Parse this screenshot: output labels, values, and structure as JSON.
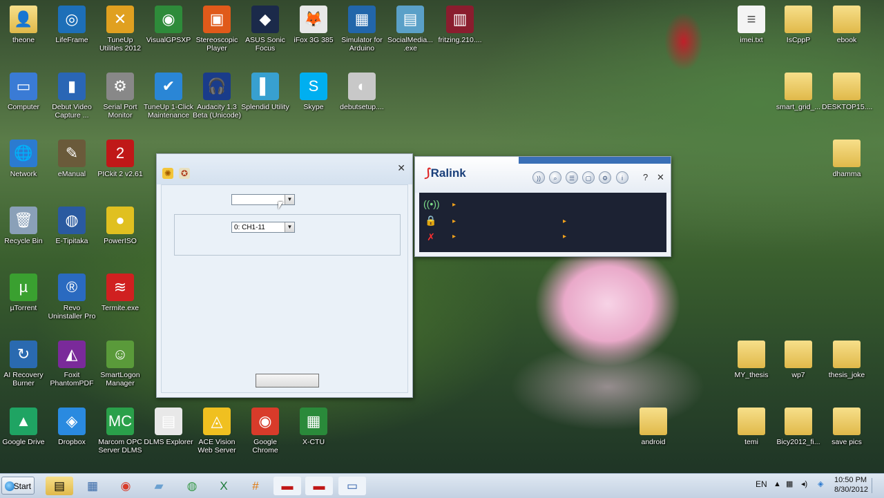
{
  "desktop_icons": [
    {
      "label": "theone",
      "kind": "folder",
      "glyph": "👤"
    },
    {
      "label": "LifeFrame",
      "kind": "app",
      "glyph": "◎",
      "color": "#1d6fb8"
    },
    {
      "label": "TuneUp Utilities 2012",
      "kind": "app",
      "glyph": "✕",
      "color": "#e0a020"
    },
    {
      "label": "VisualGPSXP",
      "kind": "app",
      "glyph": "◉",
      "color": "#2e8b3a"
    },
    {
      "label": "Stereoscopic Player",
      "kind": "app",
      "glyph": "▣",
      "color": "#e05a1a"
    },
    {
      "label": "ASUS Sonic Focus",
      "kind": "app",
      "glyph": "◆",
      "color": "#1b2a4a"
    },
    {
      "label": "iFox 3G 385",
      "kind": "app",
      "glyph": "🦊",
      "color": "#e8e8e8"
    },
    {
      "label": "Simulator for Arduino",
      "kind": "app",
      "glyph": "▦",
      "color": "#2266aa"
    },
    {
      "label": "SocialMedia... .exe",
      "kind": "app",
      "glyph": "▤",
      "color": "#5aa0c8"
    },
    {
      "label": "fritzing.210....",
      "kind": "app",
      "glyph": "▥",
      "color": "#8a1d2e"
    },
    {
      "label": "imei.txt",
      "kind": "file",
      "glyph": "≡",
      "color": "#f4f4f4"
    },
    {
      "label": "IsCppP",
      "kind": "folder",
      "glyph": ""
    },
    {
      "label": "ebook",
      "kind": "folder",
      "glyph": ""
    },
    {
      "label": "Computer",
      "kind": "app",
      "glyph": "▭",
      "color": "#3a7bd5"
    },
    {
      "label": "Debut Video Capture ...",
      "kind": "app",
      "glyph": "▮",
      "color": "#2a66b5"
    },
    {
      "label": "Serial Port Monitor",
      "kind": "app",
      "glyph": "⚙",
      "color": "#888888"
    },
    {
      "label": "TuneUp 1-Click Maintenance",
      "kind": "app",
      "glyph": "✔",
      "color": "#2a86d6"
    },
    {
      "label": "Audacity 1.3 Beta (Unicode)",
      "kind": "app",
      "glyph": "🎧",
      "color": "#1a3c8a"
    },
    {
      "label": "Splendid Utility",
      "kind": "app",
      "glyph": "▌",
      "color": "#38a0d0"
    },
    {
      "label": "Skype",
      "kind": "app",
      "glyph": "S",
      "color": "#00aff0"
    },
    {
      "label": "debutsetup....",
      "kind": "app",
      "glyph": "◐",
      "color": "#c8c8c8"
    },
    {
      "label": "smart_grid_...",
      "kind": "folder",
      "glyph": ""
    },
    {
      "label": "DESKTOP15....",
      "kind": "folder",
      "glyph": ""
    },
    {
      "label": "Network",
      "kind": "app",
      "glyph": "🌐",
      "color": "#2b7bd0"
    },
    {
      "label": "eManual",
      "kind": "app",
      "glyph": "✎",
      "color": "#6a5a3a"
    },
    {
      "label": "PICkit 2 v2.61",
      "kind": "app",
      "glyph": "2",
      "color": "#c01818"
    },
    {
      "label": "dhamma",
      "kind": "folder",
      "glyph": ""
    },
    {
      "label": "Recycle Bin",
      "kind": "app",
      "glyph": "🗑",
      "color": "#8aa0b8"
    },
    {
      "label": "E-Tipitaka",
      "kind": "app",
      "glyph": "◍",
      "color": "#2a5aa0"
    },
    {
      "label": "PowerISO",
      "kind": "app",
      "glyph": "●",
      "color": "#e0c020"
    },
    {
      "label": "µTorrent",
      "kind": "app",
      "glyph": "µ",
      "color": "#3aa030"
    },
    {
      "label": "Revo Uninstaller Pro",
      "kind": "app",
      "glyph": "®",
      "color": "#2a6ac0"
    },
    {
      "label": "Termite.exe",
      "kind": "app",
      "glyph": "≋",
      "color": "#d02020"
    },
    {
      "label": "AI Recovery Burner",
      "kind": "app",
      "glyph": "↻",
      "color": "#2a6ab0"
    },
    {
      "label": "Foxit PhantomPDF",
      "kind": "app",
      "glyph": "◭",
      "color": "#7a2a9a"
    },
    {
      "label": "SmartLogon Manager",
      "kind": "app",
      "glyph": "☺",
      "color": "#5a9a3a"
    },
    {
      "label": "Google Drive",
      "kind": "app",
      "glyph": "▲",
      "color": "#1fa463"
    },
    {
      "label": "Dropbox",
      "kind": "app",
      "glyph": "◈",
      "color": "#2a8ae0"
    },
    {
      "label": "Marcom OPC Server DLMS",
      "kind": "app",
      "glyph": "MC",
      "color": "#2aa04a"
    },
    {
      "label": "DLMS Explorer",
      "kind": "app",
      "glyph": "▤",
      "color": "#e8e8e8"
    },
    {
      "label": "ACE Vision Web Server",
      "kind": "app",
      "glyph": "◬",
      "color": "#f0c020"
    },
    {
      "label": "Google Chrome",
      "kind": "app",
      "glyph": "◉",
      "color": "#d83b2a"
    },
    {
      "label": "X-CTU",
      "kind": "app",
      "glyph": "▦",
      "color": "#2a8a3a"
    },
    {
      "label": "android",
      "kind": "folder",
      "glyph": ""
    },
    {
      "label": "temi",
      "kind": "folder",
      "glyph": ""
    },
    {
      "label": "Bicy2012_fi...",
      "kind": "folder",
      "glyph": ""
    },
    {
      "label": "save pics",
      "kind": "folder",
      "glyph": ""
    },
    {
      "label": "MY_thesis",
      "kind": "folder",
      "glyph": ""
    },
    {
      "label": "wp7",
      "kind": "folder",
      "glyph": ""
    },
    {
      "label": "thesis_joke",
      "kind": "folder",
      "glyph": ""
    }
  ],
  "dialog": {
    "combo_top_value": "",
    "combo_channel_value": "0: CH1-11",
    "button_label": ""
  },
  "ralink": {
    "logo_text": "Ralink",
    "help_glyph": "?",
    "close_glyph": "✕"
  },
  "taskbar": {
    "start_label": "Start",
    "language": "EN",
    "time": "10:50 PM",
    "date": "8/30/2012"
  }
}
